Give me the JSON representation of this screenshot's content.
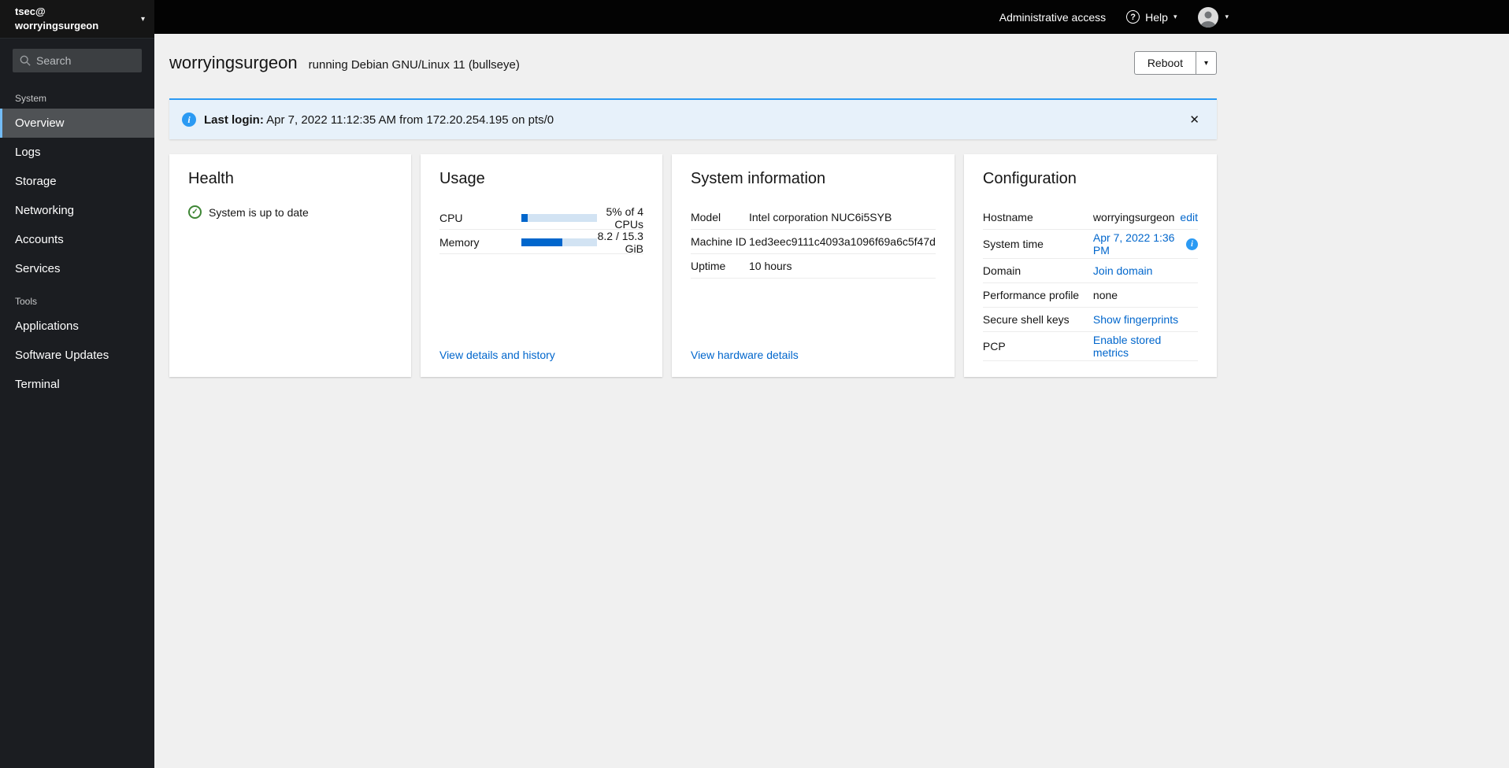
{
  "icons": {
    "caret_down": "▾",
    "close": "✕",
    "check": "✓",
    "info": "i",
    "question": "?"
  },
  "colors": {
    "link_blue": "#0066cc",
    "info_blue": "#2b9af3",
    "success_green": "#3e8635",
    "sidebar_bg": "#1b1d21",
    "masthead_bg": "#030303",
    "nav_active_accent": "#73bcf7"
  },
  "masthead": {
    "user": "tsec@",
    "host": "worryingsurgeon",
    "search_placeholder": "Search",
    "admin_access": "Administrative access",
    "help": "Help"
  },
  "sidebar": {
    "sections": [
      {
        "label": "System",
        "items": [
          {
            "label": "Overview"
          },
          {
            "label": "Logs"
          },
          {
            "label": "Storage"
          },
          {
            "label": "Networking"
          },
          {
            "label": "Accounts"
          },
          {
            "label": "Services"
          }
        ]
      },
      {
        "label": "Tools",
        "items": [
          {
            "label": "Applications"
          },
          {
            "label": "Software Updates"
          },
          {
            "label": "Terminal"
          }
        ]
      }
    ]
  },
  "header": {
    "hostname": "worryingsurgeon",
    "os": "running Debian GNU/Linux 11 (bullseye)",
    "reboot": "Reboot"
  },
  "alert": {
    "label": "Last login:",
    "message": "Apr 7, 2022 11:12:35 AM from 172.20.254.195 on pts/0"
  },
  "cards": {
    "health": {
      "title": "Health",
      "status": "System is up to date"
    },
    "usage": {
      "title": "Usage",
      "rows": [
        {
          "label": "CPU",
          "value": "5% of 4 CPUs",
          "percent": 5
        },
        {
          "label": "Memory",
          "value": "8.2 / 15.3 GiB",
          "percent": 54
        }
      ],
      "link": "View details and history"
    },
    "system_info": {
      "title": "System information",
      "rows": [
        {
          "label": "Model",
          "value": "Intel corporation NUC6i5SYB"
        },
        {
          "label": "Machine ID",
          "value": "1ed3eec9111c4093a1096f69a6c5f47d"
        },
        {
          "label": "Uptime",
          "value": "10 hours"
        }
      ],
      "link": "View hardware details"
    },
    "configuration": {
      "title": "Configuration",
      "rows": [
        {
          "label": "Hostname",
          "value": "worryingsurgeon",
          "link": "edit"
        },
        {
          "label": "System time",
          "link": "Apr 7, 2022 1:36 PM"
        },
        {
          "label": "Domain",
          "link": "Join domain"
        },
        {
          "label": "Performance profile",
          "value": "none"
        },
        {
          "label": "Secure shell keys",
          "link": "Show fingerprints"
        },
        {
          "label": "PCP",
          "link": "Enable stored metrics"
        }
      ]
    }
  }
}
